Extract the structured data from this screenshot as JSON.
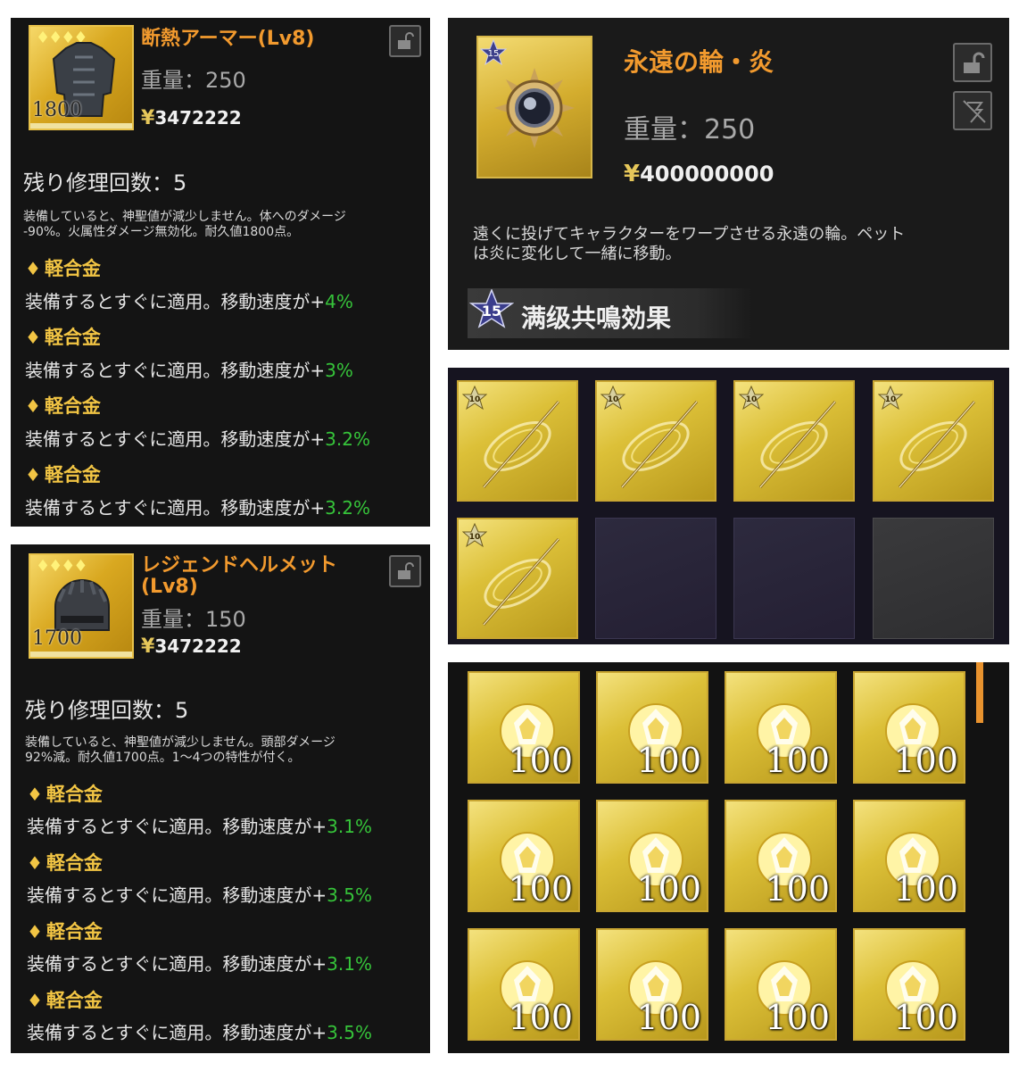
{
  "armor": {
    "title": "断熱アーマー(Lv8)",
    "weight": "重量：250",
    "price_symbol": "¥",
    "price": "3472222",
    "durability_value": "1800",
    "rarity_diamonds": "♦♦♦♦",
    "repair": "残り修理回数：5",
    "desc_1": "装備していると、神聖値が減少しません。体へのダメージ",
    "desc_2": "-90%。火属性ダメージ無効化。耐久値1800点。",
    "attributes": [
      {
        "name": "軽合金",
        "text": "装備するとすぐに適用。移動速度が+",
        "value": "4%"
      },
      {
        "name": "軽合金",
        "text": "装備するとすぐに適用。移動速度が+",
        "value": "3%"
      },
      {
        "name": "軽合金",
        "text": "装備するとすぐに適用。移動速度が+",
        "value": "3.2%"
      },
      {
        "name": "軽合金",
        "text": "装備するとすぐに適用。移動速度が+",
        "value": "3.2%"
      }
    ]
  },
  "helmet": {
    "title_1": "レジェンドヘルメット",
    "title_2": "(Lv8)",
    "weight": "重量：150",
    "price_symbol": "¥",
    "price": "3472222",
    "durability_value": "1700",
    "rarity_diamonds": "♦♦♦♦",
    "repair": "残り修理回数：5",
    "desc_1": "装備していると、神聖値が減少しません。頭部ダメージ",
    "desc_2": "92%減。耐久値1700点。1〜4つの特性が付く。",
    "attributes": [
      {
        "name": "軽合金",
        "text": "装備するとすぐに適用。移動速度が+",
        "value": "3.1%"
      },
      {
        "name": "軽合金",
        "text": "装備するとすぐに適用。移動速度が+",
        "value": "3.5%"
      },
      {
        "name": "軽合金",
        "text": "装備するとすぐに適用。移動速度が+",
        "value": "3.1%"
      },
      {
        "name": "軽合金",
        "text": "装備するとすぐに適用。移動速度が+",
        "value": "3.5%"
      }
    ]
  },
  "wheel": {
    "badge": "15",
    "title": "永遠の輪・炎",
    "weight": "重量：250",
    "price_symbol": "¥",
    "price": "400000000",
    "desc_1": "遠くに投げてキャラクターをワープさせる永遠の輪。ペット",
    "desc_2": "は炎に変化して一緒に移動。",
    "resonance_badge": "15",
    "resonance": "满级共鳴効果"
  },
  "wand_grid": {
    "badge": "10",
    "filled_slots": 5,
    "total_slots": 8
  },
  "crystal_grid": {
    "count_label": "100",
    "slots": 12
  },
  "colors": {
    "title_orange": "#f29a2e",
    "attr_gold": "#f2c544",
    "value_green": "#36c43a",
    "panel_bg": "#141414"
  },
  "icons": [
    "lock-icon",
    "no-flash-icon",
    "star-badge-icon",
    "diamond-icon",
    "armor-icon",
    "helmet-icon",
    "sun-wheel-icon",
    "wand-icon",
    "crystal-icon"
  ]
}
